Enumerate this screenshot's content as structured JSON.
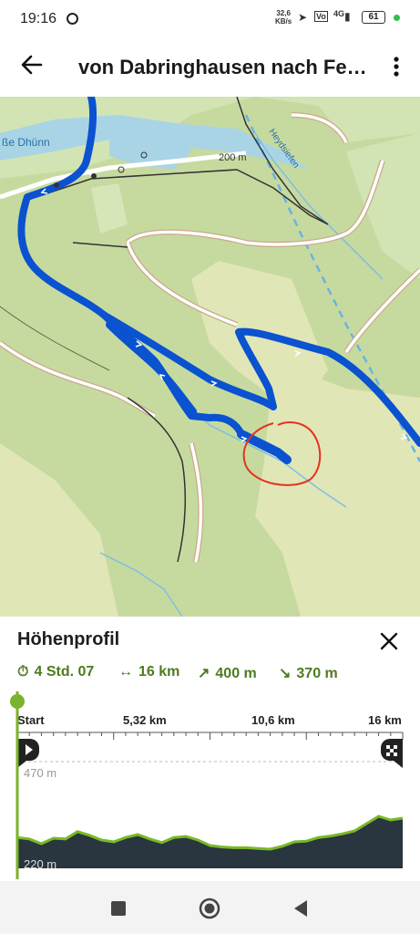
{
  "status_bar": {
    "time": "19:16",
    "net_speed_value": "32,6",
    "net_speed_unit": "KB/s",
    "signal_label": "4G",
    "battery": "61"
  },
  "app_bar": {
    "title": "von Dabringhausen nach Fe…",
    "back_icon": "arrow-left-icon",
    "more_icon": "more-vertical-icon"
  },
  "map": {
    "labels": {
      "river": "ße Dhünn",
      "stream": "Heydsiefen",
      "scale": "200 m"
    },
    "colors": {
      "route": "#0a52d0",
      "annotation_circle": "#e5321e",
      "forest": "#c6daa0",
      "meadow": "#e1e6b7",
      "water": "#a9d4e6"
    }
  },
  "elevation_panel": {
    "title": "Höhenprofil",
    "close_icon": "close-icon",
    "stats": {
      "duration": "4 Std. 07",
      "distance": "16 km",
      "ascent": "400 m",
      "descent": "370 m"
    },
    "axis": {
      "start_label": "Start",
      "mid1_label": "5,32 km",
      "mid2_label": "10,6 km",
      "end_label": "16 km"
    },
    "elevation_max_label": "470 m",
    "elevation_min_label": "220 m",
    "colors": {
      "profile_fill": "#29353f",
      "profile_outline": "#79b927",
      "progress": "#7bb32e"
    }
  },
  "chart_data": {
    "type": "area",
    "x_unit": "km",
    "y_unit": "m",
    "x": [
      0,
      0.5,
      1.0,
      1.5,
      2.0,
      2.5,
      3.0,
      3.5,
      4.0,
      4.5,
      5.0,
      5.5,
      6.0,
      6.5,
      7.0,
      7.5,
      8.0,
      8.5,
      9.0,
      9.5,
      10.0,
      10.5,
      11.0,
      11.5,
      12.0,
      12.5,
      13.0,
      13.5,
      14.0,
      14.5,
      15.0,
      15.5,
      16.0
    ],
    "y": [
      262,
      258,
      245,
      260,
      258,
      278,
      268,
      255,
      250,
      262,
      270,
      258,
      248,
      262,
      265,
      255,
      240,
      236,
      234,
      234,
      232,
      230,
      238,
      250,
      252,
      262,
      266,
      272,
      280,
      300,
      320,
      310,
      315
    ],
    "ylim": [
      220,
      470
    ],
    "xlim": [
      0,
      16
    ],
    "x_ticks": [
      "Start",
      "5,32 km",
      "10,6 km",
      "16 km"
    ],
    "y_ticks": [
      "220 m",
      "470 m"
    ],
    "grid": true
  },
  "nav_bar": {
    "recents_icon": "square-icon",
    "home_icon": "circle-icon",
    "back_icon": "triangle-back-icon"
  }
}
